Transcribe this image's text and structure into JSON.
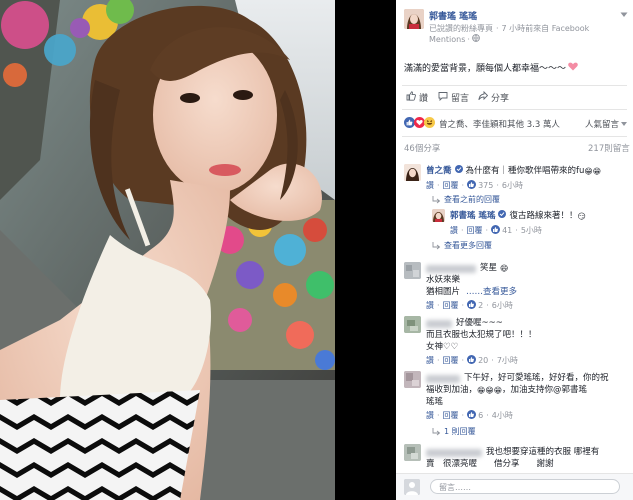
{
  "post": {
    "author": "郭書瑤 瑤瑤",
    "meta_prefix": "已說讚的粉絲專頁",
    "time_text": "7 小時前來自 Facebook",
    "mentions": "Mentions",
    "globe_icon": "globe-icon",
    "chevron_icon": "chevron-down-icon",
    "caption": "滿滿的愛當背景，願每個人都幸福～～～",
    "caption_emoji": "heart-emoji"
  },
  "actions": {
    "like": "讚",
    "comment": "留言",
    "share": "分享"
  },
  "reactions": {
    "summary": "曾之喬、李佳穎和其他 3.3 萬人",
    "sort": "人氣留言",
    "icons": [
      "like-reaction-icon",
      "love-reaction-icon",
      "haha-reaction-icon"
    ]
  },
  "counts": {
    "shares": "46個分享",
    "comments": "217則留言"
  },
  "comments": [
    {
      "name": "曾之喬",
      "verified_icon": "verified-badge-icon",
      "text": "為什麼有｜種你歌伴唱帶來的fu",
      "emoji": "😁😁",
      "like": "讚",
      "reply": "回覆",
      "likes": "375",
      "time": "6小時",
      "view_earlier": "查看之前的回覆",
      "reply_item": {
        "name": "郭書瑤 瑤瑤",
        "text": "復古路線來著！！",
        "emoji": "😏",
        "like": "讚",
        "reply": "回覆",
        "likes": "41",
        "time": "5小時"
      },
      "view_more": "查看更多回覆"
    },
    {
      "name": "",
      "text": "笑星",
      "emoji": "😄",
      "line2": "水妖來樂",
      "line3": "猶相圖片",
      "see_more": "……查看更多",
      "like": "讚",
      "reply": "回覆",
      "likes": "2",
      "time": "6小時"
    },
    {
      "name": "",
      "text": "好優喔~~~",
      "line2": "而且衣服也太犯規了吧！！！",
      "line3": "女神♡♡",
      "like": "讚",
      "reply": "回覆",
      "likes": "20",
      "time": "7小時"
    },
    {
      "name": "",
      "text": "下午好，好可愛瑤瑤，好好看，你的祝",
      "line2": "福收到加油，",
      "line2_emoji": "😁😁😁",
      "line2_tail": "，加油支持你@郭書瑤",
      "line3": "瑤瑤",
      "like": "讚",
      "reply": "回覆",
      "likes": "6",
      "time": "4小時",
      "replies": "1 則回覆"
    },
    {
      "name": "",
      "text": "我也想要穿這種的衣服 哪裡有",
      "line2": "賣　很漂亮喔　　借分享　　謝謝"
    }
  ],
  "composer": {
    "placeholder": "留言……"
  }
}
